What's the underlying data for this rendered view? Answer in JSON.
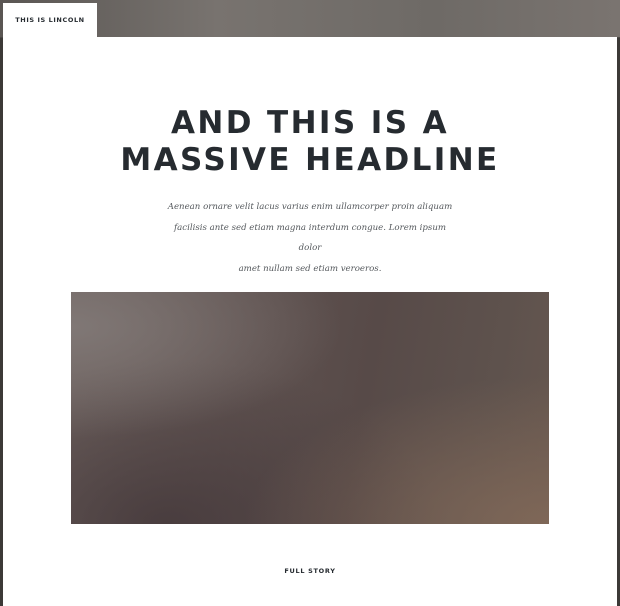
{
  "site": {
    "logo_text": "THIS IS LINCOLN"
  },
  "main": {
    "headline_line1": "AND THIS IS A",
    "headline_line2": "MASSIVE HEADLINE",
    "intro_line1": "Aenean ornare velit lacus varius enim ullamcorper proin aliquam",
    "intro_line2": "facilisis ante sed etiam magna interdum congue. Lorem ipsum dolor",
    "intro_line3": "amet nullam sed etiam veroeros.",
    "cta_label": "FULL STORY"
  }
}
